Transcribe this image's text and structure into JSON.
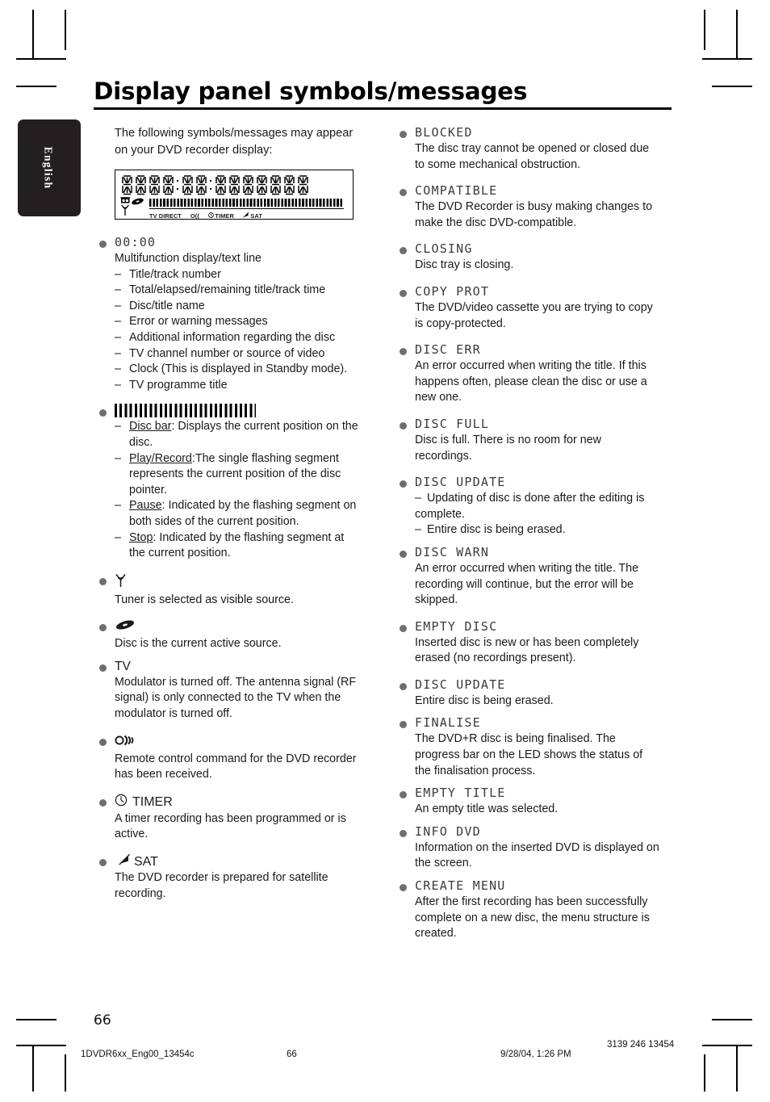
{
  "page": {
    "title": "Display panel symbols/messages",
    "language_tab": "English",
    "page_number": "66"
  },
  "intro": "The following symbols/messages may appear on your DVD recorder display:",
  "display_panel": {
    "icons": [
      "tv-direct-icon",
      "antenna-icon",
      "disc-icon"
    ],
    "labels": [
      "TV DIRECT",
      "O((",
      "TIMER",
      "SAT"
    ],
    "digit_count": 14
  },
  "left_column": [
    {
      "head": "00:00",
      "head_style": "lcd",
      "body": "Multifunction display/text line",
      "sublist": [
        "Title/track number",
        "Total/elapsed/remaining title/track time",
        "Disc/title name",
        "Error or warning messages",
        "Additional information regarding the disc",
        "TV channel number or source of video",
        "Clock (This is displayed in Standby mode).",
        "TV programme title"
      ]
    },
    {
      "head": "",
      "head_style": "discbar",
      "body": "",
      "sublist_rich": [
        {
          "term": "Disc bar",
          "sep": ": ",
          "text": "Displays the current position on the disc."
        },
        {
          "term": "Play/Record",
          "sep": ":",
          "text": "The single flashing segment represents the current position of the disc pointer."
        },
        {
          "term": "Pause",
          "sep": ": ",
          "text": "Indicated by the flashing segment on both sides of the current position."
        },
        {
          "term": "Stop",
          "sep": ": ",
          "text": "Indicated by the flashing segment at the current position."
        }
      ]
    },
    {
      "head": "",
      "head_style": "antenna-icon",
      "body": "Tuner is selected as visible source."
    },
    {
      "head": "",
      "head_style": "disc-icon",
      "body": "Disc is the current active source."
    },
    {
      "head": "TV",
      "head_style": "plain",
      "body": "Modulator is turned off. The antenna signal (RF signal) is only connected to the TV when the modulator is turned off."
    },
    {
      "head": "O((",
      "head_style": "remote-icon",
      "body": "Remote control command for the DVD recorder has been received."
    },
    {
      "head": "TIMER",
      "head_style": "clock-icon",
      "body": "A timer recording has been programmed or is active."
    },
    {
      "head": "SAT",
      "head_style": "satellite-icon",
      "body": "The DVD recorder is prepared for satellite recording."
    }
  ],
  "right_column": [
    {
      "head": "BLOCKED",
      "body": "The disc tray cannot be opened or closed due to some mechanical obstruction."
    },
    {
      "head": "COMPATIBLE",
      "body": "The DVD Recorder is busy making changes to make the disc DVD-compatible."
    },
    {
      "head": "CLOSING",
      "body": "Disc tray is closing."
    },
    {
      "head": "COPY PROT",
      "body": "The DVD/video cassette you are trying to copy is copy-protected."
    },
    {
      "head": "DISC ERR",
      "body": "An error occurred when writing the title. If this happens often, please clean the disc or use a new one."
    },
    {
      "head": "DISC FULL",
      "body": "Disc is full. There is no room for new recordings."
    },
    {
      "head": "DISC UPDATE",
      "body": "",
      "sublist": [
        "Updating of disc is done after the editing is complete.",
        "Entire disc is being erased."
      ]
    },
    {
      "head": "DISC WARN",
      "body": "An error occurred when writing the title. The recording will continue, but the error will be skipped."
    },
    {
      "head": "EMPTY DISC",
      "body": "Inserted disc is new or has been completely erased (no recordings present)."
    },
    {
      "head": "DISC UPDATE",
      "body": "Entire disc is being erased."
    },
    {
      "head": "FINALISE",
      "body": "The DVD+R disc is being finalised. The progress bar on the LED shows the status of the finalisation process."
    },
    {
      "head": "EMPTY TITLE",
      "body": "An empty title was selected."
    },
    {
      "head": "INFO DVD",
      "body": "Information on the inserted DVD is displayed on the screen."
    },
    {
      "head": "CREATE MENU",
      "body": "After the first recording has been successfully complete on a new disc, the menu structure is created."
    }
  ],
  "footer": {
    "file": "1DVDR6xx_Eng00_13454c",
    "page": "66",
    "date": "9/28/04, 1:26 PM",
    "code": "3139 246 13454"
  },
  "colors": {
    "bullet": "#6e6e6e",
    "lcd_text": "#3b3b3b",
    "ink": "#1a1a1a",
    "tab_bg": "#231f20"
  }
}
